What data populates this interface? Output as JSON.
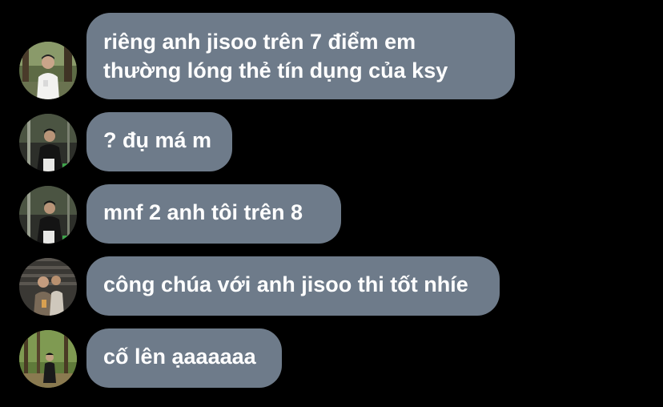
{
  "messages": [
    {
      "text_lines": [
        "riêng anh jisoo trên 7 điểm em",
        "thường lóng thẻ tín dụng của ksy"
      ],
      "avatar": "avatar-man-white-shirt-forest"
    },
    {
      "text_lines": [
        "? đụ má m"
      ],
      "avatar": "avatar-man-dark-jacket-street"
    },
    {
      "text_lines": [
        "mnf 2 anh tôi trên 8"
      ],
      "avatar": "avatar-man-dark-jacket-street"
    },
    {
      "text_lines": [
        "công chúa với anh jisoo thi tốt nhíe"
      ],
      "avatar": "avatar-group-photo-brick"
    },
    {
      "text_lines": [
        "cố lên ạaaaaaa"
      ],
      "avatar": "avatar-man-in-forest"
    }
  ],
  "colors": {
    "background": "#000000",
    "bubble": "#6e7b8a",
    "text": "#ffffff"
  }
}
